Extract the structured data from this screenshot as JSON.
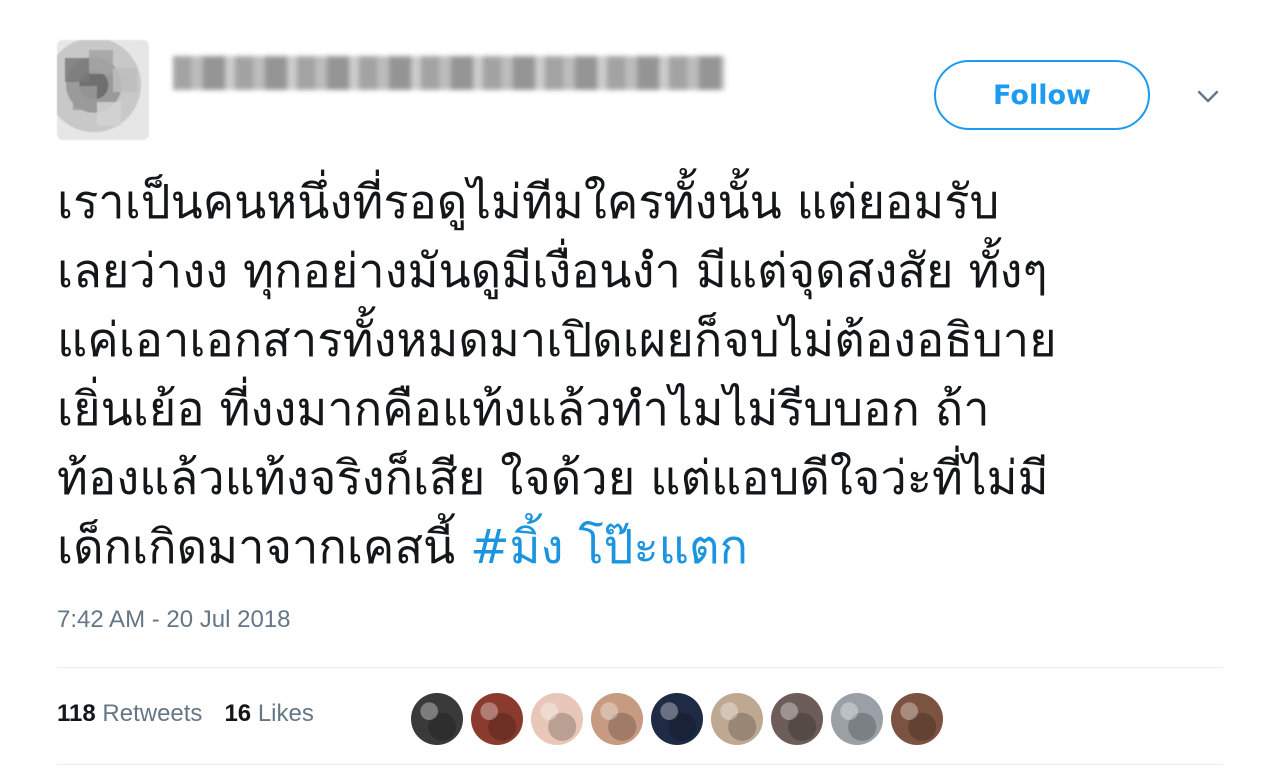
{
  "header": {
    "follow_label": "Follow"
  },
  "tweet": {
    "lines": [
      "เราเป็นคนหนึ่งที่รอดูไม่ทีมใครทั้งนั้น แต่ยอมรับ",
      "เลยว่างง ทุกอย่างมันดูมีเงื่อนงำ มีแต่จุดสงสัย ทั้งๆ",
      "แค่เอาเอกสารทั้งหมดมาเปิดเผยก็จบไม่ต้องอธิบาย",
      "เยิ่นเย้อ ที่งงมากคือแท้งแล้วทำไมไม่รีบบอก ถ้า",
      "ท้องแล้วแท้งจริงก็เสีย ใจด้วย แต่แอบดีใจว่ะที่ไม่มี"
    ],
    "last_line_text": "เด็กเกิดมาจากเคสนี้ ",
    "hashtag": "#มิ้ง โป๊ะแตก",
    "timestamp": "7:42 AM - 20 Jul 2018"
  },
  "stats": {
    "retweets_count": "118",
    "retweets_label": "Retweets",
    "likes_count": "16",
    "likes_label": "Likes"
  },
  "likers": [
    {
      "icon": "avatar-dark-gray",
      "color": "#3a3a3a"
    },
    {
      "icon": "avatar-red-brown",
      "color": "#8a3b2e"
    },
    {
      "icon": "avatar-light-figure",
      "color": "#e9c7b8"
    },
    {
      "icon": "avatar-tan",
      "color": "#c79a82"
    },
    {
      "icon": "avatar-navy",
      "color": "#1f2a44"
    },
    {
      "icon": "avatar-beige",
      "color": "#bfa892"
    },
    {
      "icon": "avatar-group-photo",
      "color": "#6c5d58"
    },
    {
      "icon": "avatar-building",
      "color": "#9aa0a6"
    },
    {
      "icon": "avatar-warm-brown",
      "color": "#7c5240"
    }
  ],
  "colors": {
    "accent": "#1d9bf0",
    "text": "#14171a",
    "muted": "#657786",
    "divider": "#e6ecf0"
  }
}
